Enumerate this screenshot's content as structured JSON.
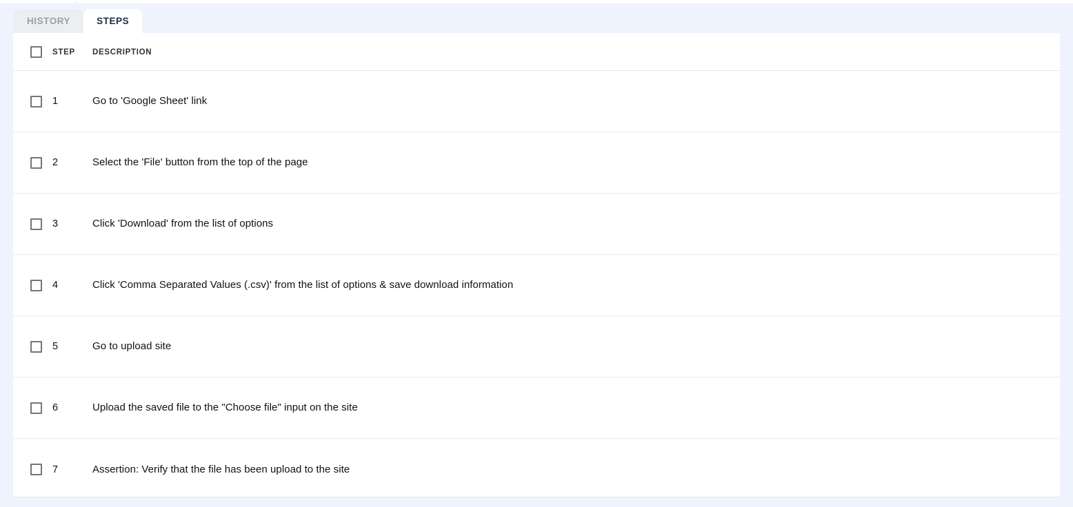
{
  "tabs": [
    {
      "id": "history",
      "label": "HISTORY",
      "active": false
    },
    {
      "id": "steps",
      "label": "STEPS",
      "active": true
    }
  ],
  "table": {
    "select_all_checkbox": "unchecked",
    "columns": {
      "checkbox": "",
      "step": "STEP",
      "description": "DESCRIPTION"
    },
    "rows": [
      {
        "checked": "unchecked",
        "step": "1",
        "description": "Go to 'Google Sheet' link"
      },
      {
        "checked": "unchecked",
        "step": "2",
        "description": "Select the 'File' button from the top of the page"
      },
      {
        "checked": "unchecked",
        "step": "3",
        "description": "Click 'Download' from the list of options"
      },
      {
        "checked": "unchecked",
        "step": "4",
        "description": "Click 'Comma Separated Values (.csv)' from the list of options & save download information"
      },
      {
        "checked": "unchecked",
        "step": "5",
        "description": "Go to upload site"
      },
      {
        "checked": "unchecked",
        "step": "6",
        "description": "Upload the saved file to the \"Choose file\" input on the site"
      },
      {
        "checked": "unchecked",
        "step": "7",
        "description": "Assertion: Verify that the file has been upload to the site"
      }
    ]
  },
  "colors": {
    "page_background": "#eff3fd",
    "card_background": "#ffffff",
    "tab_inactive_background": "#eceff1",
    "tab_inactive_text": "#9a9fa4",
    "tab_active_text": "#1b2b44",
    "row_divider": "#e9eaec",
    "checkbox_border": "#757575",
    "body_text": "#101114"
  }
}
